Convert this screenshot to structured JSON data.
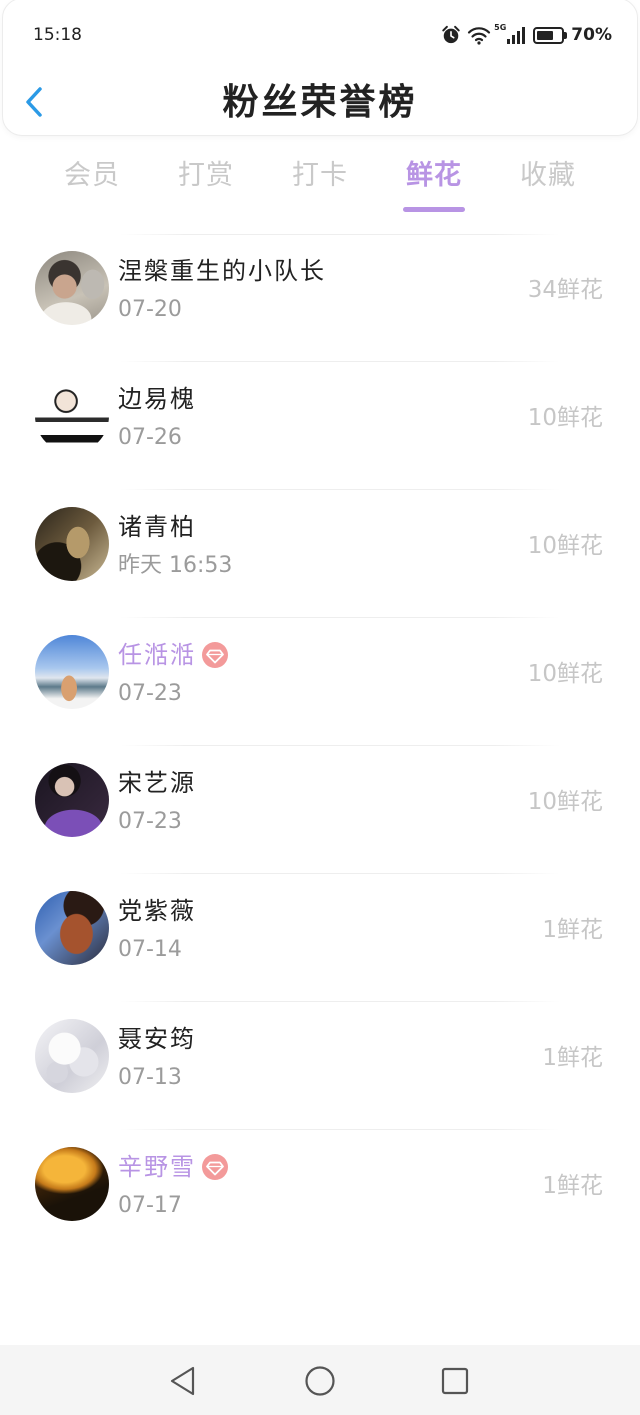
{
  "status_bar": {
    "time": "15:18",
    "network": "5G",
    "battery": "70%",
    "battery_level": 0.7,
    "icons": [
      "alarm-icon",
      "wifi-icon",
      "signal-icon",
      "battery-icon"
    ]
  },
  "header": {
    "title": "粉丝荣誉榜",
    "back_icon": "chevron-left-icon"
  },
  "tabs": [
    {
      "label": "会员",
      "active": false
    },
    {
      "label": "打赏",
      "active": false
    },
    {
      "label": "打卡",
      "active": false
    },
    {
      "label": "鲜花",
      "active": true
    },
    {
      "label": "收藏",
      "active": false
    }
  ],
  "list": [
    {
      "name": "涅槃重生的小队长",
      "date": "07-20",
      "count": "34鲜花",
      "vip": false
    },
    {
      "name": "边易槐",
      "date": "07-26",
      "count": "10鲜花",
      "vip": false
    },
    {
      "name": "诸青柏",
      "date": "昨天 16:53",
      "count": "10鲜花",
      "vip": false
    },
    {
      "name": "任湉湉",
      "date": "07-23",
      "count": "10鲜花",
      "vip": true
    },
    {
      "name": "宋艺源",
      "date": "07-23",
      "count": "10鲜花",
      "vip": false
    },
    {
      "name": "党紫薇",
      "date": "07-14",
      "count": "1鲜花",
      "vip": false
    },
    {
      "name": "聂安筠",
      "date": "07-13",
      "count": "1鲜花",
      "vip": false
    },
    {
      "name": "辛野雪",
      "date": "07-17",
      "count": "1鲜花",
      "vip": true
    }
  ],
  "vip_badge_icon": "diamond-icon",
  "nav_bar": {
    "icons": [
      "back-triangle-icon",
      "home-circle-icon",
      "recents-square-icon"
    ]
  },
  "colors": {
    "accent": "#b894e4",
    "back_arrow": "#2b9ae6",
    "vip_badge": "#f39a9a",
    "title_text": "#222222",
    "tab_inactive": "#c9c9c9",
    "date_text": "#9b9b9b",
    "count_text": "#c6c6c6"
  }
}
